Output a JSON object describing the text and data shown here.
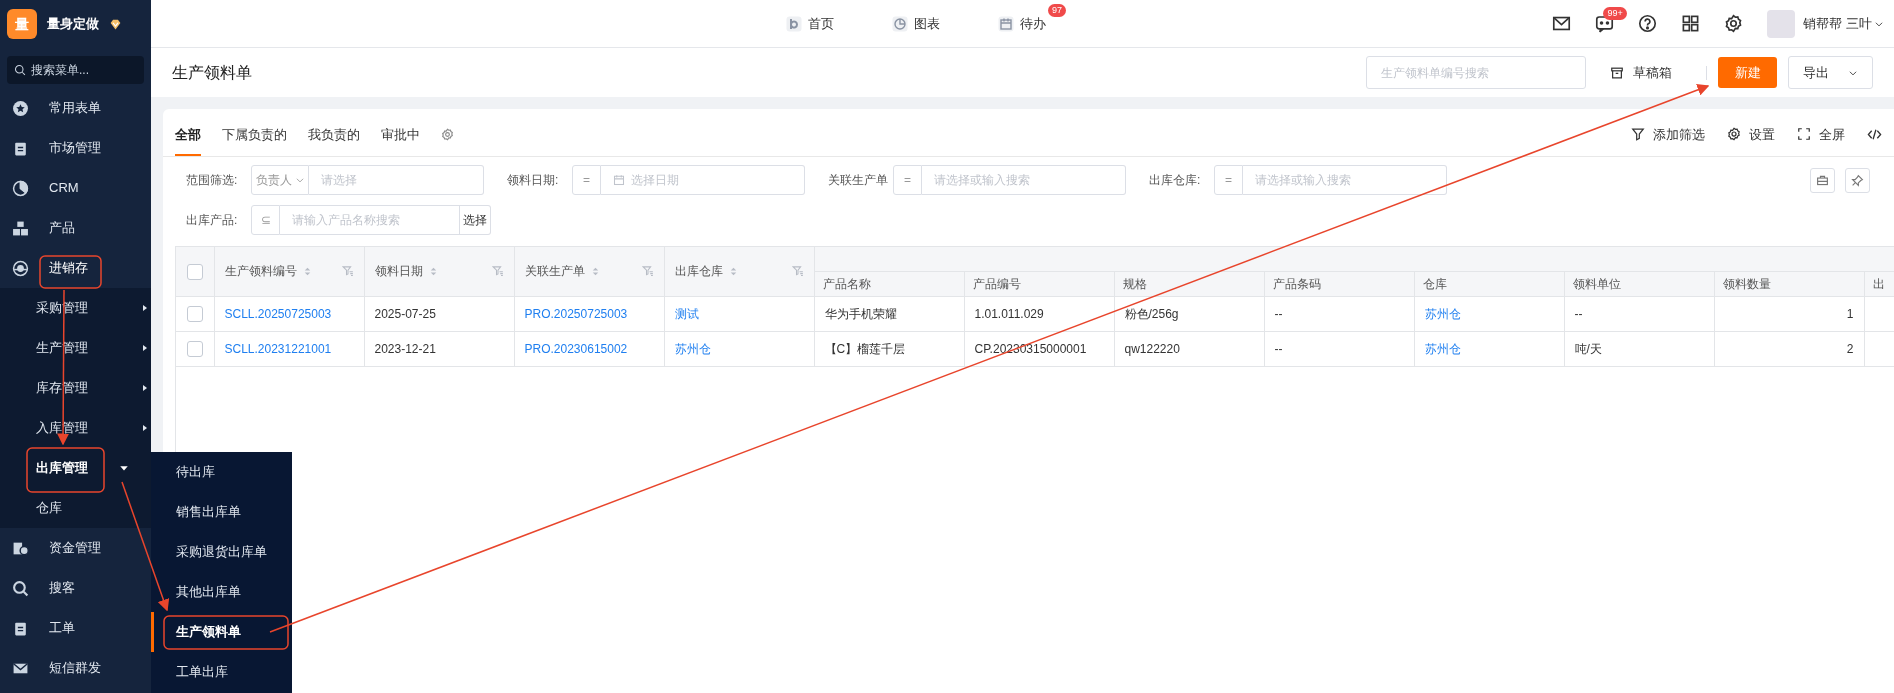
{
  "sidebar": {
    "logo": "量",
    "brand": "量身定做",
    "search_placeholder": "搜索菜单...",
    "items": [
      {
        "label": "常用表单",
        "expanded": false
      },
      {
        "label": "市场管理",
        "expanded": false
      },
      {
        "label": "CRM",
        "expanded": false
      },
      {
        "label": "产品",
        "expanded": false
      },
      {
        "label": "进销存",
        "expanded": true,
        "children": [
          {
            "label": "采购管理",
            "kind": "submenu",
            "expanded": false
          },
          {
            "label": "生产管理",
            "kind": "submenu",
            "expanded": false
          },
          {
            "label": "库存管理",
            "kind": "submenu",
            "expanded": false
          },
          {
            "label": "入库管理",
            "kind": "submenu",
            "expanded": false
          },
          {
            "label": "出库管理",
            "kind": "submenu",
            "expanded": true,
            "children": [
              {
                "label": "待出库",
                "selected": false
              },
              {
                "label": "销售出库单",
                "selected": false
              },
              {
                "label": "采购退货出库单",
                "selected": false
              },
              {
                "label": "其他出库单",
                "selected": false
              },
              {
                "label": "生产领料单",
                "selected": true
              },
              {
                "label": "工单出库",
                "selected": false
              }
            ]
          },
          {
            "label": "仓库",
            "kind": "link"
          }
        ]
      },
      {
        "label": "资金管理",
        "expanded": false
      },
      {
        "label": "搜客",
        "expanded": false
      },
      {
        "label": "工单",
        "expanded": false
      },
      {
        "label": "短信群发",
        "expanded": false
      }
    ]
  },
  "top_nav": [
    {
      "label": "首页"
    },
    {
      "label": "图表"
    },
    {
      "label": "待办",
      "badge": "97"
    }
  ],
  "header_icons": [
    {
      "kind": "mail"
    },
    {
      "kind": "chat",
      "badge": "99+"
    },
    {
      "kind": "help"
    },
    {
      "kind": "grid"
    },
    {
      "kind": "settings"
    }
  ],
  "user": {
    "name": "销帮帮 三叶"
  },
  "page": {
    "title": "生产领料单",
    "search_placeholder": "生产领料单编号搜索",
    "drafts": "草稿箱",
    "new": "新建",
    "export": "导出"
  },
  "tabs": [
    {
      "label": "全部",
      "selected": true
    },
    {
      "label": "下属负责的",
      "selected": false
    },
    {
      "label": "我负责的",
      "selected": false
    },
    {
      "label": "审批中",
      "selected": false
    }
  ],
  "tools": [
    "添加筛选",
    "设置",
    "全屏"
  ],
  "filters": [
    {
      "label": "范围筛选:",
      "operator": "负责人",
      "kind": "dropdown",
      "placeholder": "请选择"
    },
    {
      "label": "领料日期:",
      "operator": "=",
      "kind": "date",
      "placeholder": "选择日期"
    },
    {
      "label": "关联生产单",
      "operator": "=",
      "kind": "text",
      "placeholder": "请选择或输入搜索"
    },
    {
      "label": "出库仓库:",
      "operator": "=",
      "kind": "text",
      "placeholder": "请选择或输入搜索"
    },
    {
      "label": "出库产品:",
      "operator": "⊆",
      "kind": "picker",
      "placeholder": "请输入产品名称搜索",
      "button": "选择"
    }
  ],
  "table": {
    "all_checked": false,
    "columns": [
      {
        "label": "生产领料编号",
        "kind": "link",
        "sortable": true
      },
      {
        "label": "领料日期",
        "kind": "text",
        "sortable": true
      },
      {
        "label": "关联生产单",
        "kind": "link",
        "sortable": true
      },
      {
        "label": "出库仓库",
        "kind": "link",
        "sortable": true
      },
      {
        "label": "产品名称",
        "kind": "text",
        "sortable": false
      },
      {
        "label": "产品编号",
        "kind": "text",
        "sortable": false
      },
      {
        "label": "规格",
        "kind": "text",
        "sortable": false
      },
      {
        "label": "产品条码",
        "kind": "text",
        "sortable": false
      },
      {
        "label": "仓库",
        "kind": "link",
        "sortable": false
      },
      {
        "label": "领料单位",
        "kind": "text",
        "sortable": false
      },
      {
        "label": "领料数量",
        "kind": "number",
        "sortable": false
      },
      {
        "label": "出",
        "kind": "text",
        "sortable": false
      }
    ],
    "rows": [
      {
        "checked": false,
        "cells": [
          "SCLL.20250725003",
          "2025-07-25",
          "PRO.20250725003",
          "测试",
          "华为手机荣耀",
          "1.01.011.029",
          "粉色/256g",
          "--",
          "苏州仓",
          "--",
          "1"
        ]
      },
      {
        "checked": false,
        "cells": [
          "SCLL.20231221001",
          "2023-12-21",
          "PRO.20230615002",
          "苏州仓",
          "【C】榴莲千层",
          "CP.20230315000001",
          "qw122220",
          "--",
          "苏州仓",
          "吨/天",
          "2"
        ]
      }
    ]
  }
}
